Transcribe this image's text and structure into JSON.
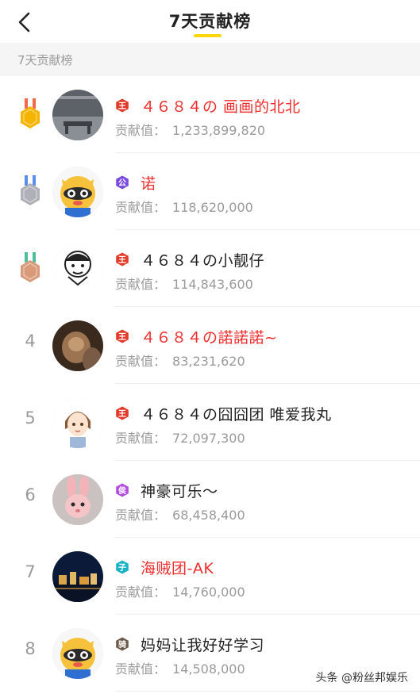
{
  "header": {
    "title": "7天贡献榜"
  },
  "section": {
    "title": "7天贡献榜"
  },
  "contrib_label": "贡献值：",
  "colors": {
    "accent_yellow": "#ffd60a",
    "highlight_red": "#f02d2d",
    "gold": "#f5b400",
    "silver": "#b0b0b8",
    "bronze": "#d99a7a"
  },
  "rows": [
    {
      "rank": "1",
      "badge": "medal-gold",
      "tag": "王",
      "tag_color": "#e23a2a",
      "name": "４６８４の 画画的北北",
      "name_red": true,
      "value": "1,233,899,820"
    },
    {
      "rank": "2",
      "badge": "medal-silver",
      "tag": "公",
      "tag_color": "#7a4be0",
      "name": "诺",
      "name_red": true,
      "value": "118,620,000"
    },
    {
      "rank": "3",
      "badge": "medal-bronze",
      "tag": "王",
      "tag_color": "#e23a2a",
      "name": "４６８４の小靓仔",
      "name_red": false,
      "value": "114,843,600"
    },
    {
      "rank": "4",
      "badge": "",
      "tag": "王",
      "tag_color": "#e23a2a",
      "name": "４６８４の諾諾諾~",
      "name_red": true,
      "value": "83,231,620"
    },
    {
      "rank": "5",
      "badge": "",
      "tag": "王",
      "tag_color": "#e23a2a",
      "name": "４６８４の囧囧团 唯爱我丸",
      "name_red": false,
      "value": "72,097,300"
    },
    {
      "rank": "6",
      "badge": "",
      "tag": "侯",
      "tag_color": "#b44be0",
      "name": "神豪可乐～",
      "name_red": false,
      "value": "68,458,400"
    },
    {
      "rank": "7",
      "badge": "",
      "tag": "子",
      "tag_color": "#19b3c4",
      "name": "海贼团-AK",
      "name_red": true,
      "value": "14,760,000"
    },
    {
      "rank": "8",
      "badge": "",
      "tag": "骑",
      "tag_color": "#6b5a4a",
      "name": "妈妈让我好好学习",
      "name_red": false,
      "value": "14,508,000"
    }
  ],
  "watermark": "头条 @粉丝邦娱乐"
}
